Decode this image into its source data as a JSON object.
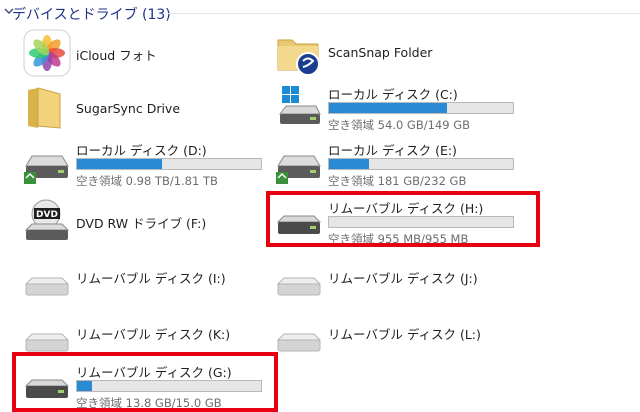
{
  "group": {
    "title": "デバイスとドライブ (13)"
  },
  "items": {
    "icloud": {
      "name": "iCloud フォト"
    },
    "scansnap": {
      "name": "ScanSnap Folder"
    },
    "sugarsync": {
      "name": "SugarSync Drive"
    },
    "c": {
      "name": "ローカル ディスク (C:)",
      "free": "空き領域 54.0 GB/149 GB",
      "used_fraction": 0.64
    },
    "d": {
      "name": "ローカル ディスク (D:)",
      "free": "空き領域 0.98 TB/1.81 TB",
      "used_fraction": 0.46
    },
    "e": {
      "name": "ローカル ディスク (E:)",
      "free": "空き領域 181 GB/232 GB",
      "used_fraction": 0.22
    },
    "f": {
      "name": "DVD RW ドライブ (F:)"
    },
    "h": {
      "name": "リムーバブル ディスク (H:)",
      "free": "空き領域 955 MB/955 MB",
      "used_fraction": 0.0
    },
    "i": {
      "name": "リムーバブル ディスク (I:)"
    },
    "j": {
      "name": "リムーバブル ディスク (J:)"
    },
    "k": {
      "name": "リムーバブル ディスク (K:)"
    },
    "l": {
      "name": "リムーバブル ディスク (L:)"
    },
    "g": {
      "name": "リムーバブル ディスク (G:)",
      "free": "空き領域 13.8 GB/15.0 GB",
      "used_fraction": 0.08
    }
  },
  "icons": {
    "icloud": "icloud-photos-icon",
    "scansnap": "scansnap-folder-icon",
    "sugarsync": "folder-icon",
    "local_disk": "hard-drive-icon",
    "system_disk": "windows-drive-icon",
    "dvd": "dvd-drive-icon",
    "removable": "removable-drive-icon"
  },
  "colors": {
    "bar_fill": "#2a8ad4",
    "highlight": "#e60012",
    "group_title": "#1e3287"
  }
}
